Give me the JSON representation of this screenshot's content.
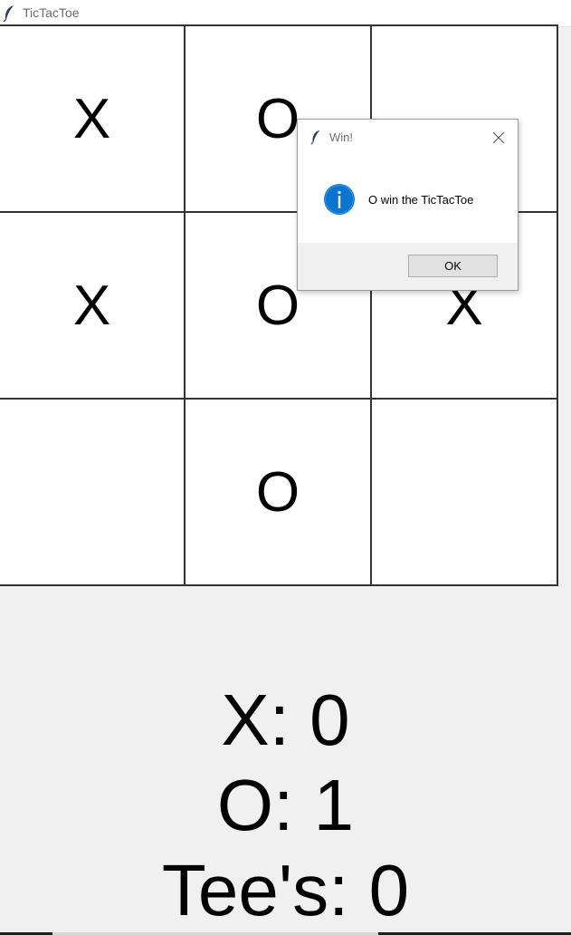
{
  "window": {
    "title": "TicTacToe",
    "icon": "feather-icon"
  },
  "board": {
    "cells": [
      "X",
      "O",
      "",
      "X",
      "O",
      "X",
      "",
      "O",
      ""
    ]
  },
  "scores": {
    "x_line": "X: 0",
    "o_line": "O: 1",
    "tees_line": "Tee's: 0"
  },
  "dialog": {
    "title": "Win!",
    "icon": "info-icon",
    "message": "O win the TicTacToe",
    "ok_label": "OK"
  },
  "colors": {
    "background": "#f0f0f0",
    "board_lines": "#333333",
    "info_icon": "#0a74d0"
  }
}
